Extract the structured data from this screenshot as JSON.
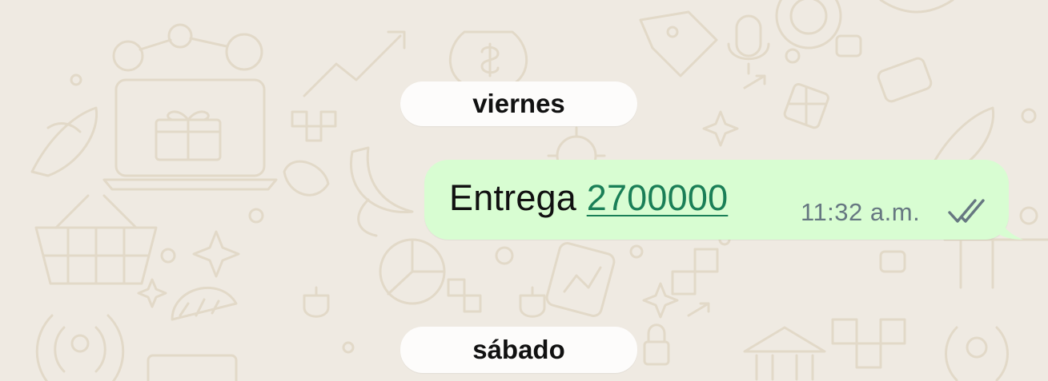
{
  "chat": {
    "date_dividers": [
      "viernes",
      "sábado"
    ],
    "message": {
      "text": "Entrega ",
      "link_text": "2700000",
      "time": "11:32 a.m.",
      "status_icon": "double-check-icon"
    }
  },
  "colors": {
    "wallpaper_bg": "#efeae2",
    "wallpaper_doodle": "#e2d9c8",
    "outgoing_bubble": "#d8fdd2",
    "link": "#1a7f57",
    "timestamp": "#667781",
    "date_chip_bg": "#fdfcfb"
  }
}
